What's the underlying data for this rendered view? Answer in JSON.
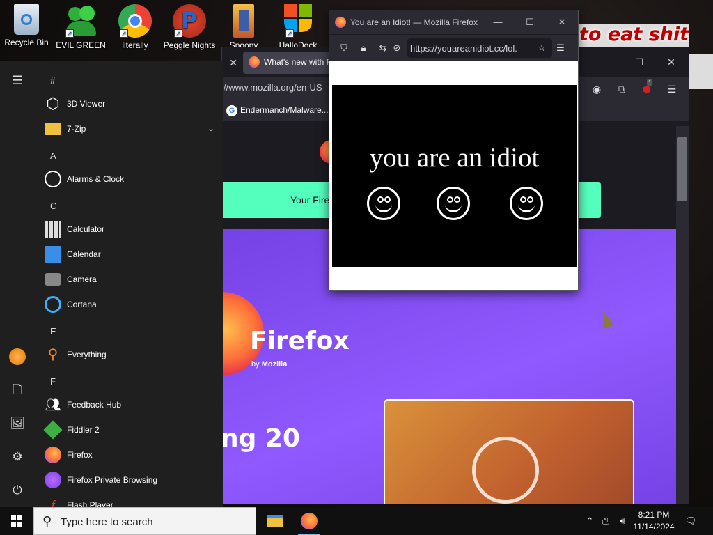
{
  "desktop": {
    "icons": [
      {
        "label": "Recycle Bin",
        "icon": "recycle-bin-icon"
      },
      {
        "label": "EVIL GREEN",
        "icon": "evil-green-icon"
      },
      {
        "label": "literally",
        "icon": "chrome-icon"
      },
      {
        "label": "Peggle Nights",
        "icon": "peggle-icon"
      },
      {
        "label": "Spoopy",
        "icon": "spoopy-icon"
      },
      {
        "label": "HalloDock",
        "icon": "windows-shield-icon"
      }
    ],
    "meme_text": "to eat shit"
  },
  "ff_back": {
    "tab2_label": "What's new with Fi",
    "url": "//www.mozilla.org/en-US",
    "bookmark": "Endermanch/Malware...",
    "notice": "Your Fire",
    "hero_word": "Firefox",
    "hero_by": "by",
    "hero_by_brand": "Mozilla",
    "headline": "ng 20",
    "extension_badge": "1"
  },
  "popup": {
    "title": "You are an Idiot! — Mozilla Firefox",
    "url": "https://youareanidiot.cc/lol.",
    "message": "you are an idiot"
  },
  "start_menu": {
    "sections": [
      {
        "letter": "#",
        "apps": [
          {
            "label": "3D Viewer",
            "icon": "cube-icon"
          },
          {
            "label": "7-Zip",
            "icon": "folder-icon",
            "expandable": true
          }
        ]
      },
      {
        "letter": "A",
        "apps": [
          {
            "label": "Alarms & Clock",
            "icon": "alarm-clock-icon"
          }
        ]
      },
      {
        "letter": "C",
        "apps": [
          {
            "label": "Calculator",
            "icon": "calculator-icon"
          },
          {
            "label": "Calendar",
            "icon": "calendar-icon"
          },
          {
            "label": "Camera",
            "icon": "camera-icon"
          },
          {
            "label": "Cortana",
            "icon": "cortana-icon"
          }
        ]
      },
      {
        "letter": "E",
        "apps": [
          {
            "label": "Everything",
            "icon": "magnifier-icon"
          }
        ]
      },
      {
        "letter": "F",
        "apps": [
          {
            "label": "Feedback Hub",
            "icon": "feedback-icon"
          },
          {
            "label": "Fiddler 2",
            "icon": "fiddler-icon"
          },
          {
            "label": "Firefox",
            "icon": "firefox-icon"
          },
          {
            "label": "Firefox Private Browsing",
            "icon": "firefox-private-icon"
          },
          {
            "label": "Flash Player",
            "icon": "flash-icon"
          }
        ]
      }
    ]
  },
  "taskbar": {
    "search_placeholder": "Type here to search",
    "time": "8:21 PM",
    "date": "11/14/2024"
  },
  "colors": {
    "accent_green": "#54ffbd",
    "hero_purple": "#7542e5",
    "firefox_orange": "#ff7139"
  }
}
